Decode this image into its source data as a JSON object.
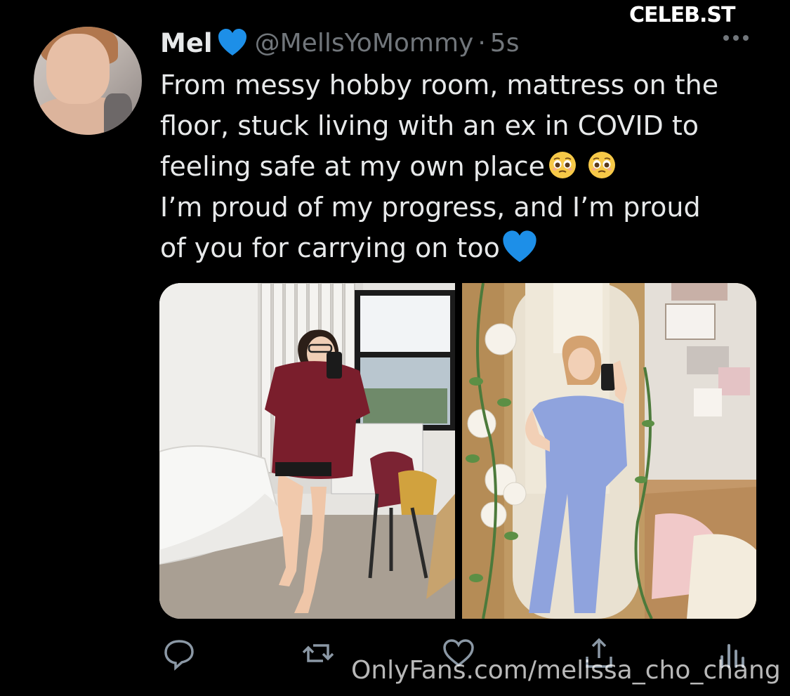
{
  "tweet": {
    "display_name": "Mel",
    "handle": "@MellsYoMommy",
    "separator": "·",
    "timestamp": "5s",
    "text_lines": [
      "From messy hobby room, mattress on the",
      "floor, stuck living with an ex in COVID to",
      "feeling safe at my own place",
      "I’m proud of my progress, and I’m proud",
      "of you for carrying on too"
    ]
  },
  "icons": {
    "name_badge": "blue-heart-icon",
    "line3_emojis": [
      "pleading-face-icon",
      "pleading-face-icon"
    ],
    "line5_emoji": "blue-heart-icon",
    "more": "more-dots-icon",
    "actions": [
      "reply-icon",
      "retweet-icon",
      "like-icon",
      "share-icon",
      "analytics-icon"
    ]
  },
  "watermarks": {
    "top_right": "CELEB.ST",
    "bottom": "OnlyFans.com/melissa_cho_chang"
  },
  "colors": {
    "background": "#000000",
    "text": "#e7e9ea",
    "secondary": "#71767b",
    "heart_blue": "#1d8fe8"
  }
}
